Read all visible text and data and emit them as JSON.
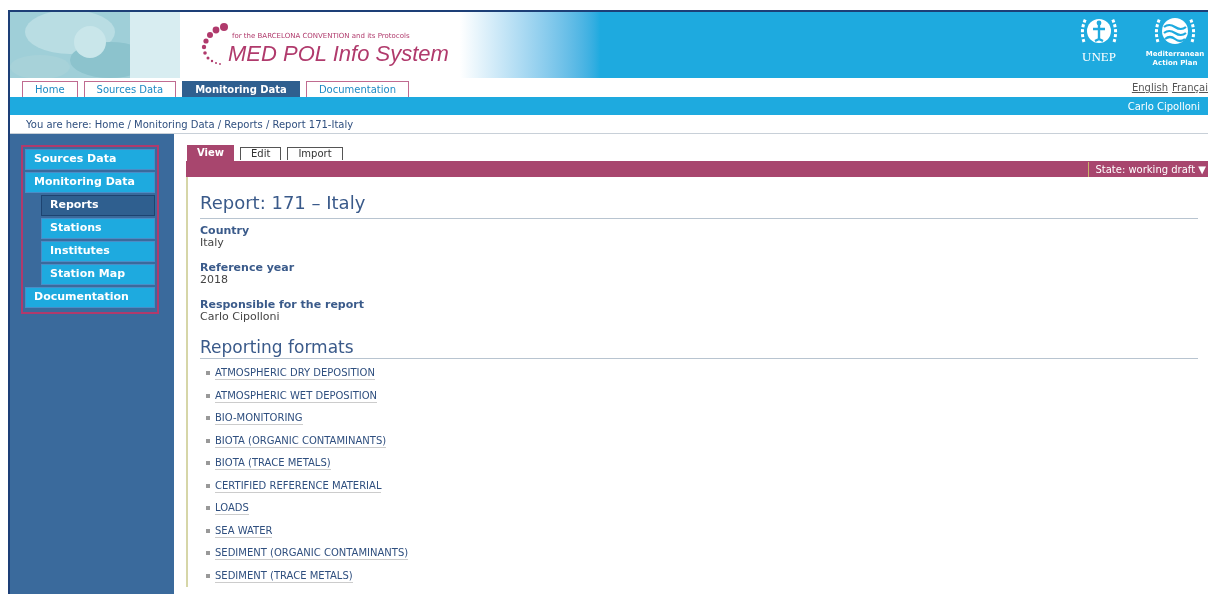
{
  "header": {
    "tagline": "for the BARCELONA CONVENTION and its Protocols",
    "site_title": "MED POL Info System",
    "emblems": [
      {
        "kind": "unep",
        "label": "UNEP"
      },
      {
        "kind": "map",
        "label": "Mediterranean Action Plan"
      }
    ]
  },
  "nav_tabs": [
    {
      "label": "Home",
      "selected": false
    },
    {
      "label": "Sources Data",
      "selected": false
    },
    {
      "label": "Monitoring Data",
      "selected": true
    },
    {
      "label": "Documentation",
      "selected": false
    }
  ],
  "languages": [
    "English",
    "Françai"
  ],
  "user_name": "Carlo Cipolloni",
  "breadcrumb": "You are here: Home / Monitoring Data / Reports / Report 171-Italy",
  "sidebar": {
    "items": [
      {
        "label": "Sources Data",
        "selected": false
      },
      {
        "label": "Monitoring Data",
        "selected": false,
        "children": [
          {
            "label": "Reports",
            "selected": true
          },
          {
            "label": "Stations",
            "selected": false
          },
          {
            "label": "Institutes",
            "selected": false
          },
          {
            "label": "Station Map",
            "selected": false
          }
        ]
      },
      {
        "label": "Documentation",
        "selected": false
      }
    ]
  },
  "content_tabs": [
    {
      "label": "View",
      "selected": true
    },
    {
      "label": "Edit",
      "selected": false
    },
    {
      "label": "Import",
      "selected": false
    }
  ],
  "state_menu": "State: working draft ▼",
  "title": "Report: 171 – Italy",
  "fields": [
    {
      "label": "Country",
      "value": "Italy"
    },
    {
      "label": "Reference year",
      "value": "2018"
    },
    {
      "label": "Responsible for the report",
      "value": "Carlo Cipolloni"
    }
  ],
  "formats_heading": "Reporting formats",
  "formats": [
    "ATMOSPHERIC DRY DEPOSITION",
    "ATMOSPHERIC WET DEPOSITION",
    "BIO-MONITORING",
    "BIOTA (ORGANIC CONTAMINANTS)",
    "BIOTA (TRACE METALS)",
    "CERTIFIED REFERENCE MATERIAL",
    "LOADS",
    "SEA WATER",
    "SEDIMENT (ORGANIC CONTAMINANTS)",
    "SEDIMENT (TRACE METALS)"
  ]
}
